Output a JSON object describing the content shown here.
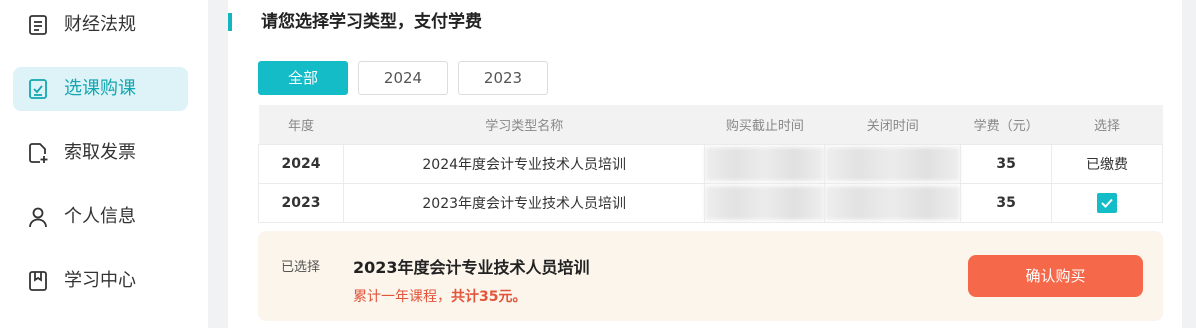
{
  "sidebar": {
    "items": [
      {
        "label": "财经法规",
        "icon": "document-icon"
      },
      {
        "label": "选课购课",
        "icon": "checklist-icon"
      },
      {
        "label": "索取发票",
        "icon": "invoice-add-icon"
      },
      {
        "label": "个人信息",
        "icon": "user-icon"
      },
      {
        "label": "学习中心",
        "icon": "bookmark-icon"
      }
    ],
    "active_index": 1
  },
  "main": {
    "title": "请您选择学习类型，支付学费",
    "tabs": [
      {
        "label": "全部",
        "active": true
      },
      {
        "label": "2024",
        "active": false
      },
      {
        "label": "2023",
        "active": false
      }
    ],
    "table": {
      "headers": [
        "年度",
        "学习类型名称",
        "购买截止时间",
        "关闭时间",
        "学费（元）",
        "选择"
      ],
      "rows": [
        {
          "year": "2024",
          "name": "2024年度会计专业技术人员培训",
          "deadline": "",
          "close": "",
          "fee": "35",
          "select": "已缴费",
          "checked": false
        },
        {
          "year": "2023",
          "name": "2023年度会计专业技术人员培训",
          "deadline": "",
          "close": "",
          "fee": "35",
          "select": "",
          "checked": true
        }
      ]
    },
    "summary": {
      "label": "已选择",
      "course": "2023年度会计专业技术人员培训",
      "note_prefix": "累计一年课程，",
      "note_total": "共计35元。",
      "button": "确认购买"
    }
  },
  "colors": {
    "accent": "#14bcc8",
    "fee": "#e56e4a",
    "button": "#f5684a",
    "summary_bg": "#fbf5ec"
  }
}
